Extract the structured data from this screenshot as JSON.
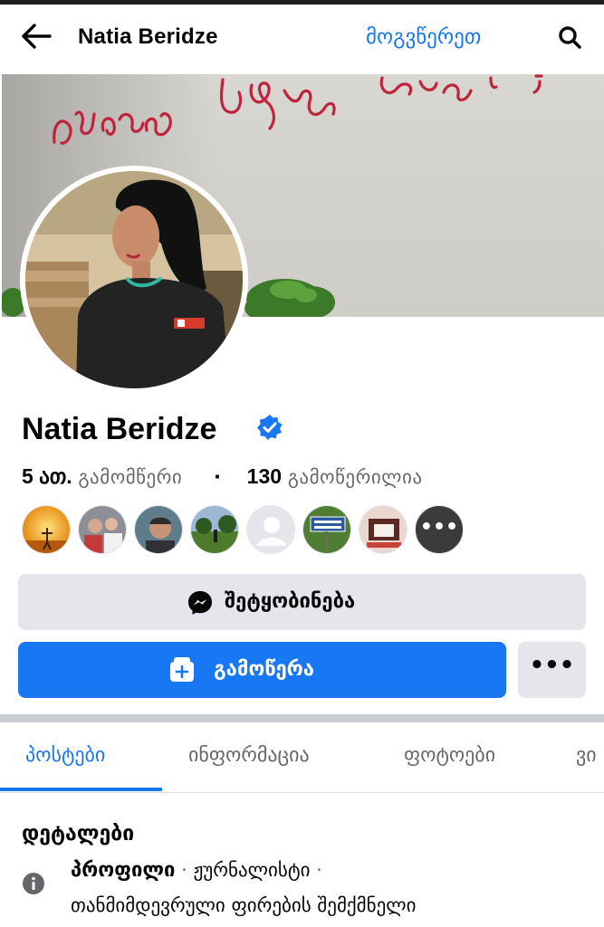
{
  "header": {
    "title": "Natia Beridze",
    "follow_link": "მოგვწერეთ"
  },
  "profile": {
    "name": "Natia Beridze",
    "verified": true,
    "followers_count": "5 ათ.",
    "followers_label": "გამომწერი",
    "following_count": "130",
    "following_label": "გამოწერილია"
  },
  "follower_avatars": [
    "sunset-avatar",
    "group-avatar",
    "selfie-avatar",
    "field-avatar",
    "default-avatar",
    "bazaleti-avatar",
    "room-avatar",
    "more-avatar"
  ],
  "buttons": {
    "message": "შეტყობინება",
    "follow": "გამოწერა",
    "more": "•••"
  },
  "tabs": [
    {
      "label": "პოსტები",
      "active": true
    },
    {
      "label": "ინფორმაცია",
      "active": false
    },
    {
      "label": "ფოტოები",
      "active": false
    },
    {
      "label": "ვი",
      "active": false
    }
  ],
  "details": {
    "title": "დეტალები",
    "profile_key": "პროფილი",
    "profile_job": "ჟურნალისტი",
    "profile_desc": "თანმიმდევრული ფირების შემქმნელი"
  },
  "colors": {
    "accent": "#1877f2",
    "secondary_button": "#e4e6eb",
    "muted_text": "#65676b",
    "graffiti": "#c0233a"
  }
}
